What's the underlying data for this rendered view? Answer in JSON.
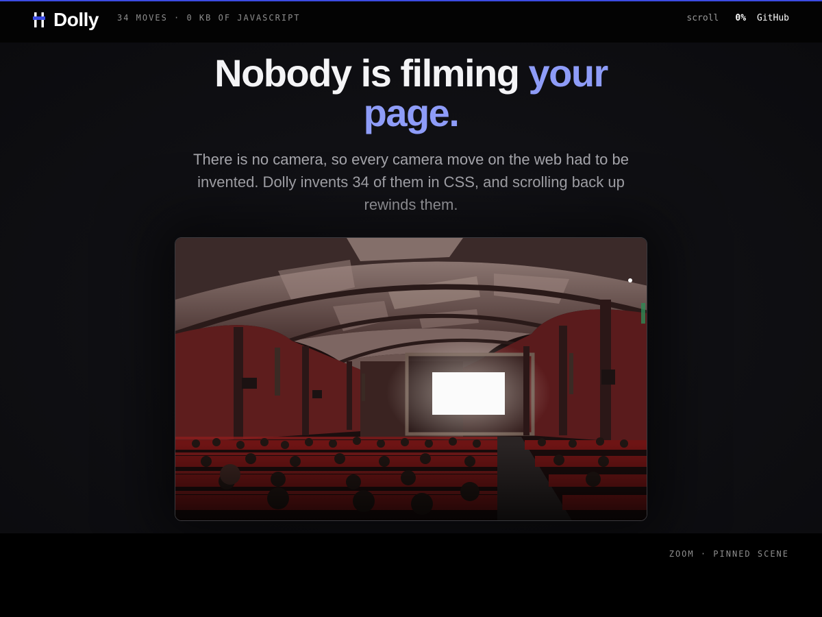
{
  "header": {
    "brand_name": "Dolly",
    "brand_icon": "dolly-logo-icon",
    "tagline": "34 MOVES · 0 KB OF JAVASCRIPT",
    "scroll_label": "scroll",
    "scroll_progress": "0%",
    "github_label": "GitHub"
  },
  "hero": {
    "title_plain": "Nobody is filming ",
    "title_accent": "your page.",
    "subtitle": "There is no camera, so every camera move on the web had to be invented. Dolly invents 34 of them in CSS, and scrolling back up rewinds them.",
    "image_alt": "Audience seated in a dark, arched cinema facing a bright screen"
  },
  "footer": {
    "scene_label": "ZOOM · PINNED SCENE"
  },
  "colors": {
    "accent": "#8e9cf8",
    "progress_bar": "#3b4be3",
    "background": "#030303"
  }
}
